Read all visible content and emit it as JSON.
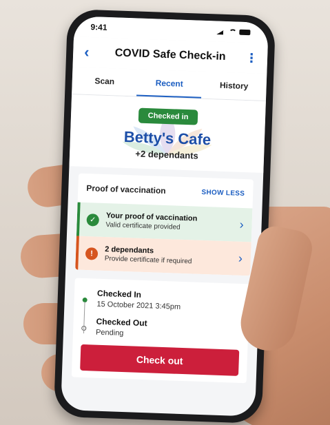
{
  "status_bar": {
    "time": "9:41"
  },
  "header": {
    "title": "COVID Safe Check-in",
    "back_icon": "‹",
    "more_icon": "⋮"
  },
  "tabs": [
    {
      "label": "Scan",
      "active": false
    },
    {
      "label": "Recent",
      "active": true
    },
    {
      "label": "History",
      "active": false
    }
  ],
  "hero": {
    "badge": "Checked in",
    "venue": "Betty's Cafe",
    "dependants": "+2 dependants"
  },
  "proof": {
    "title": "Proof of vaccination",
    "toggle_label": "SHOW LESS",
    "items": [
      {
        "title": "Your proof of vaccination",
        "subtitle": "Valid certificate provided",
        "status": "valid"
      },
      {
        "title": "2 dependants",
        "subtitle": "Provide certificate if required",
        "status": "warning"
      }
    ]
  },
  "timeline": {
    "checked_in": {
      "label": "Checked In",
      "value": "15 October 2021 3:45pm"
    },
    "checked_out": {
      "label": "Checked Out",
      "value": "Pending"
    }
  },
  "actions": {
    "checkout_label": "Check out"
  },
  "colors": {
    "accent": "#1d5fc2",
    "success": "#2a8a3c",
    "warning": "#d6551f",
    "danger": "#cc1f3b"
  }
}
